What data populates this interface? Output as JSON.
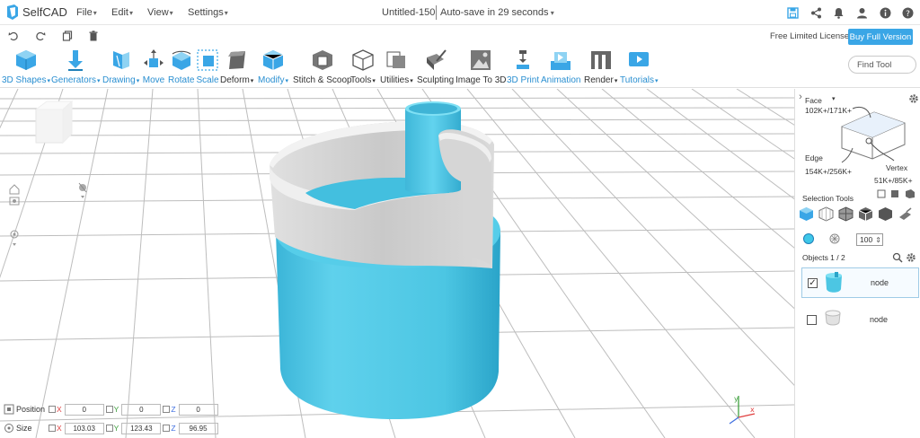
{
  "app": {
    "name": "SelfCAD"
  },
  "menu": [
    "File",
    "Edit",
    "View",
    "Settings"
  ],
  "document": {
    "title": "Untitled-150",
    "autosave": "Auto-save in 29 seconds"
  },
  "license": {
    "label": "Free Limited License",
    "buy_label": "Buy Full Version"
  },
  "toolbar": {
    "items": [
      {
        "label": "3D Shapes",
        "icon": "cube-icon",
        "style": "blue",
        "dropdown": true
      },
      {
        "label": "Generators",
        "icon": "generator-icon",
        "style": "blue",
        "dropdown": true
      },
      {
        "label": "Drawing",
        "icon": "pencil-icon",
        "style": "blue",
        "dropdown": true
      },
      {
        "label": "Move",
        "icon": "move-icon",
        "style": "blue",
        "dropdown": false
      },
      {
        "label": "Rotate",
        "icon": "rotate-icon",
        "style": "blue",
        "dropdown": false
      },
      {
        "label": "Scale",
        "icon": "scale-icon",
        "style": "blue",
        "dropdown": false
      },
      {
        "label": "Deform",
        "icon": "deform-icon",
        "style": "dark",
        "dropdown": true
      },
      {
        "label": "Modify",
        "icon": "modify-icon",
        "style": "blue",
        "dropdown": true
      },
      {
        "label": "Stitch & Scoop",
        "icon": "stitch-scoop-icon",
        "style": "dark",
        "dropdown": false
      },
      {
        "label": "Tools",
        "icon": "tools-icon",
        "style": "dark",
        "dropdown": true
      },
      {
        "label": "Utilities",
        "icon": "utilities-icon",
        "style": "dark",
        "dropdown": true
      },
      {
        "label": "Sculpting",
        "icon": "sculpting-icon",
        "style": "dark",
        "dropdown": false
      },
      {
        "label": "Image To 3D",
        "icon": "image-to-3d-icon",
        "style": "dark",
        "dropdown": false
      },
      {
        "label": "3D Print",
        "icon": "printer-icon",
        "style": "blue",
        "dropdown": false
      },
      {
        "label": "Animation",
        "icon": "animation-icon",
        "style": "blue",
        "dropdown": false
      },
      {
        "label": "Render",
        "icon": "render-icon",
        "style": "dark",
        "dropdown": true
      },
      {
        "label": "Tutorials",
        "icon": "tutorials-icon",
        "style": "blue",
        "dropdown": true
      }
    ],
    "find_placeholder": "Find Tool"
  },
  "transform": {
    "position_label": "Position",
    "size_label": "Size",
    "axis_labels": [
      "X",
      "Y",
      "Z"
    ],
    "position": [
      "0",
      "0",
      "0"
    ],
    "size": [
      "103.03",
      "123.43",
      "96.95"
    ]
  },
  "panel": {
    "face_label": "Face",
    "face_count": "102K+/171K+",
    "edge_label": "Edge",
    "edge_count": "154K+/256K+",
    "vertex_label": "Vertex",
    "vertex_count": "51K+/85K+",
    "selection_tools_label": "Selection Tools",
    "opacity": "100",
    "objects_label": "Objects 1 / 2",
    "objects": [
      {
        "name": "node",
        "checked": true,
        "thumb": "blue-cup-thumbnail"
      },
      {
        "name": "node",
        "checked": false,
        "thumb": "white-cup-thumbnail"
      }
    ]
  },
  "colors": {
    "accent": "#3aa6e6",
    "model_blue": "#4cc6e3",
    "model_gray": "#d8d8d8"
  }
}
